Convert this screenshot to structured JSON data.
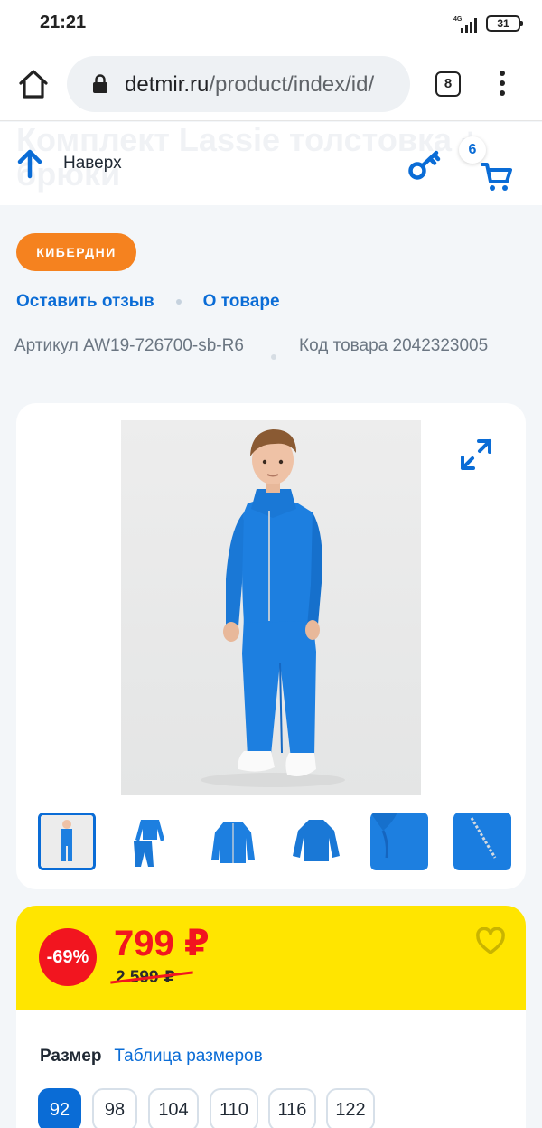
{
  "status_bar": {
    "time": "21:21",
    "network": "4G",
    "battery": "31"
  },
  "browser": {
    "url_host": "detmir.ru",
    "url_path": "/product/index/id/",
    "tab_count": "8"
  },
  "header": {
    "ghost_title_line1": "Комплект Lassie толстовка +",
    "ghost_title_line2": "брюки",
    "up_label": "Наверх",
    "cart_count": "6"
  },
  "product": {
    "promo_badge": "КИБЕРДНИ",
    "actions": {
      "review": "Оставить отзыв",
      "about": "О товаре"
    },
    "article": "Артикул AW19-726700-sb-R6",
    "code": "Код товара 2042323005"
  },
  "price": {
    "discount": "-69%",
    "current": "799 ₽",
    "old": "2 599 ₽"
  },
  "sizes": {
    "title": "Размер",
    "chart_link": "Таблица размеров",
    "options": [
      "92",
      "98",
      "104",
      "110",
      "116",
      "122"
    ],
    "selected": "92"
  },
  "colors": {
    "accent_blue": "#0a6cd6",
    "promo_orange": "#f5821f",
    "price_yellow": "#ffe500",
    "price_red": "#f2151f",
    "garment_blue": "#1d7fe0"
  }
}
